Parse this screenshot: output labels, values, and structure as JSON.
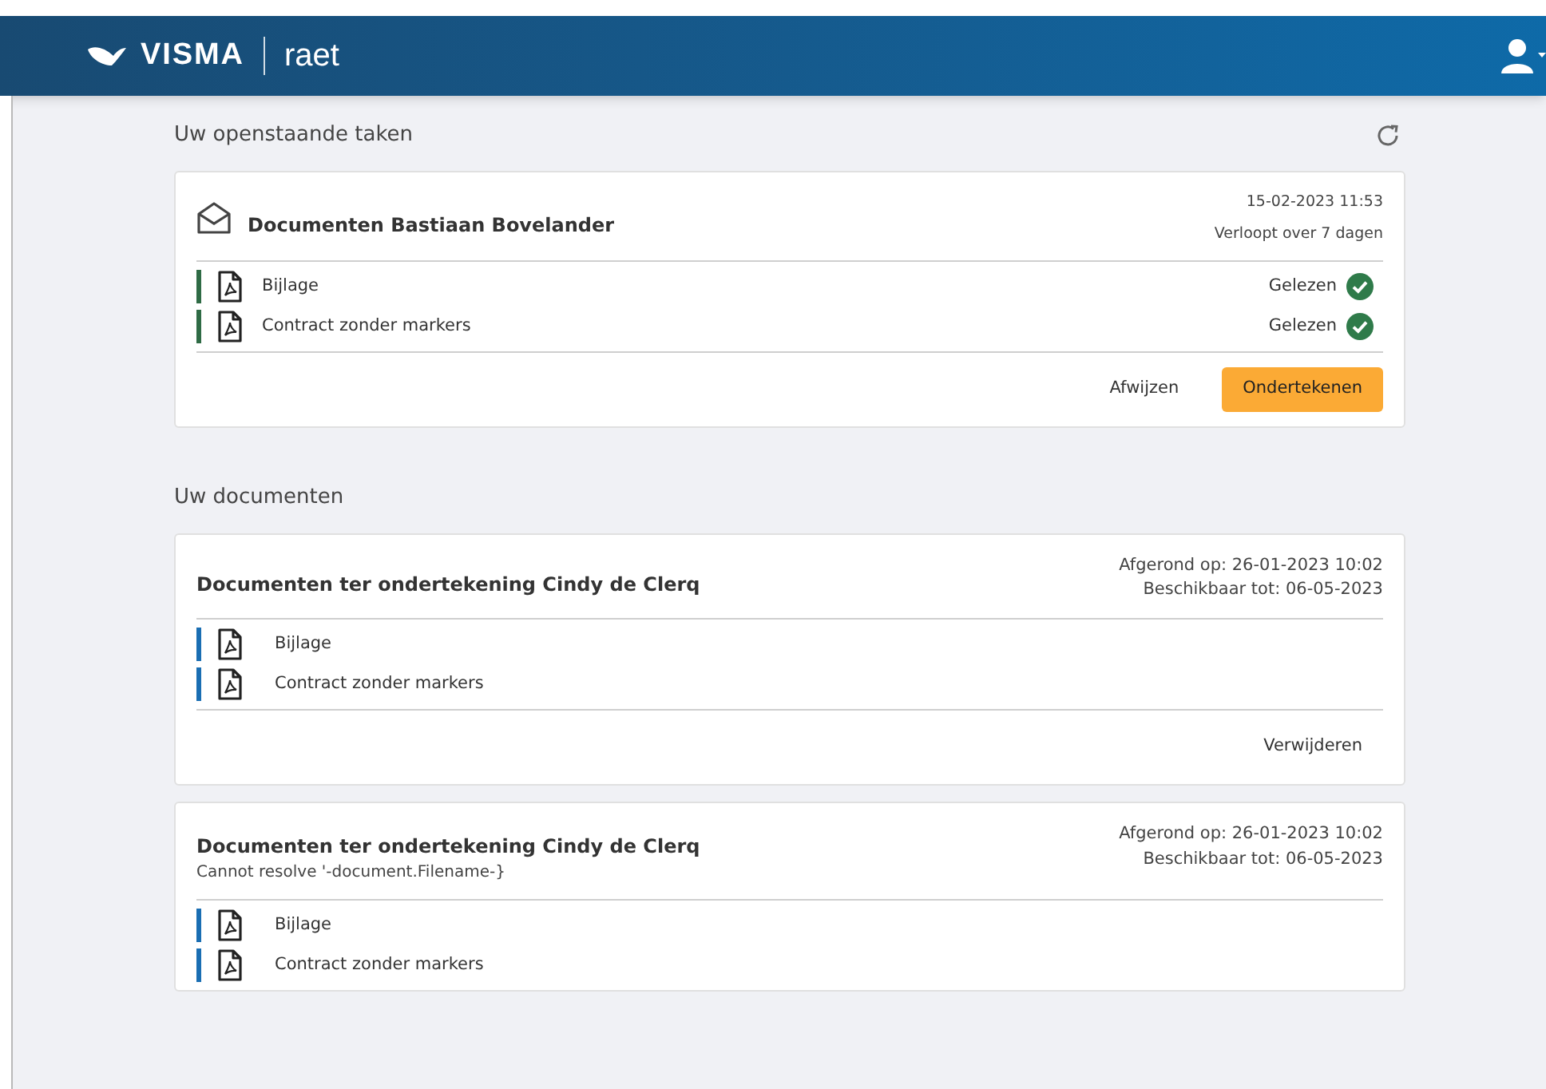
{
  "header": {
    "brand": "VISMA",
    "product": "raet"
  },
  "tasks": {
    "title": "Uw openstaande taken",
    "cards": [
      {
        "title": "Documenten Bastiaan Bovelander",
        "meta": [
          "15-02-2023 11:53",
          "Verloopt over 7 dagen"
        ],
        "documents": [
          {
            "name": "Bijlage",
            "read": true,
            "status": "Gelezen"
          },
          {
            "name": "Contract zonder markers",
            "read": true,
            "status": "Gelezen"
          }
        ],
        "actions": [
          {
            "label": "Afwijzen",
            "primary": false
          },
          {
            "label": "Ondertekenen",
            "primary": true
          }
        ]
      }
    ]
  },
  "documents": {
    "title": "Uw documenten",
    "cards": [
      {
        "title": "Documenten ter ondertekening Cindy de Clerq",
        "meta": [
          "Afgerond op: 26-01-2023 10:02",
          "Beschikbaar tot: 06-05-2023"
        ],
        "documents": [
          {
            "name": "Bijlage",
            "read": false
          },
          {
            "name": "Contract zonder markers",
            "read": false
          }
        ],
        "actions": [
          {
            "label": "Verwijderen",
            "primary": false
          }
        ]
      },
      {
        "title": "Documenten ter ondertekening Cindy de Clerq",
        "subtitle": "Cannot resolve '-document.Filename-}",
        "meta": [
          "Afgerond op: 26-01-2023 10:02",
          "Beschikbaar tot: 06-05-2023"
        ],
        "documents": [
          {
            "name": "Bijlage",
            "read": false
          },
          {
            "name": "Contract zonder markers",
            "read": false
          }
        ]
      }
    ]
  }
}
